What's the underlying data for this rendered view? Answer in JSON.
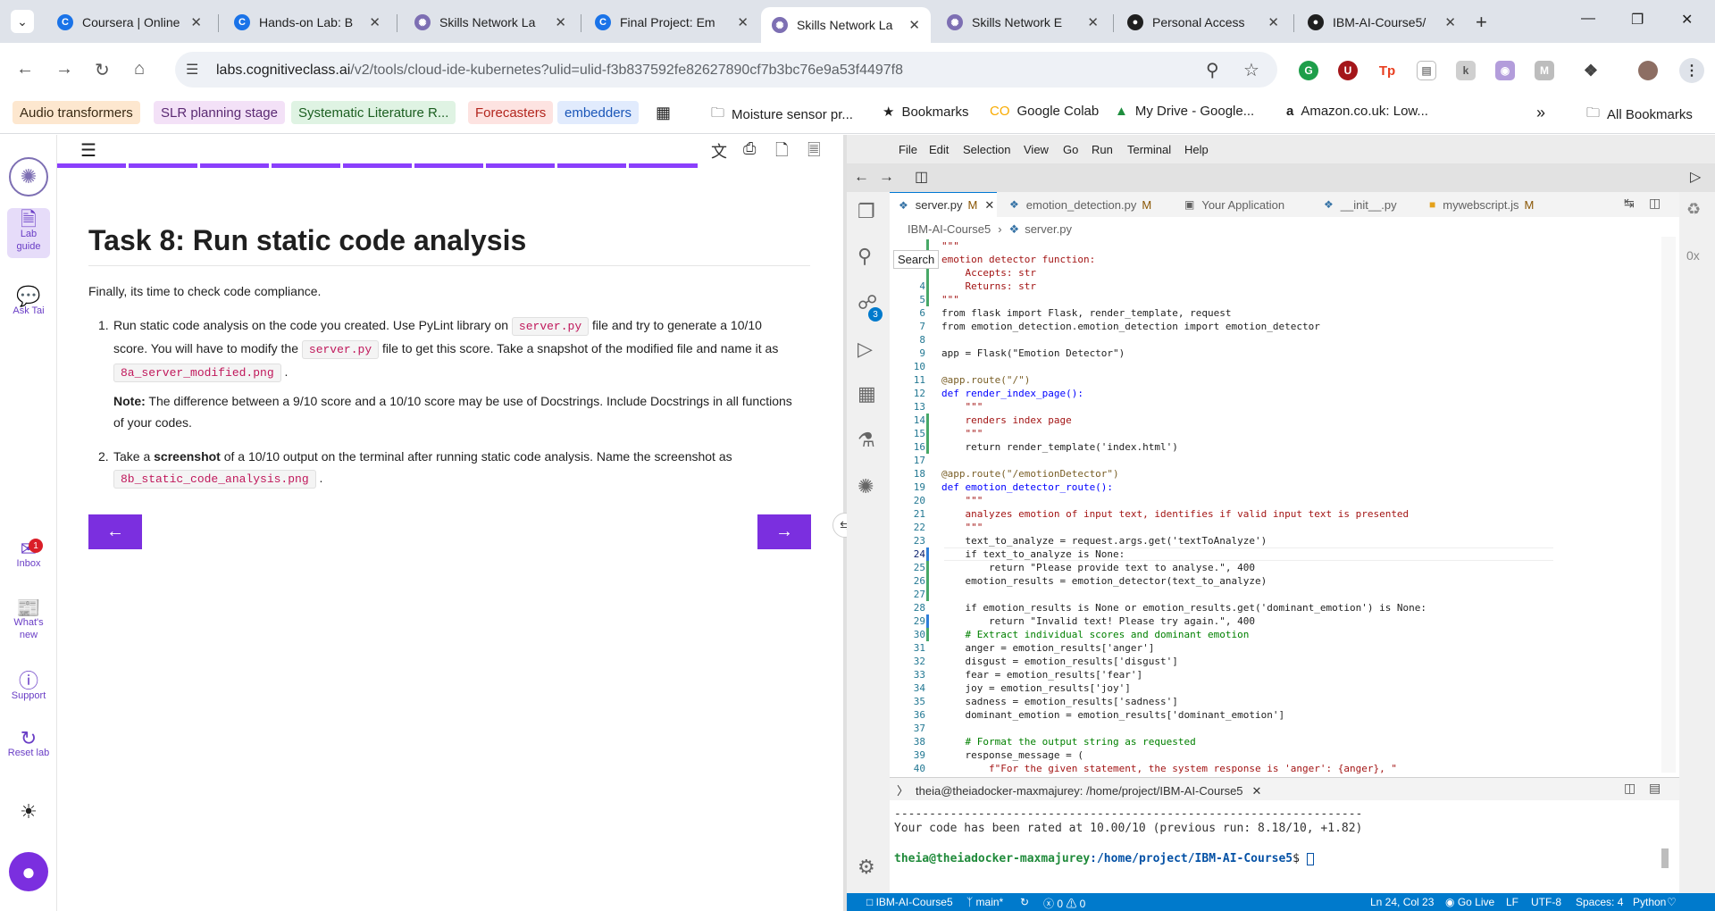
{
  "browser": {
    "tabs": [
      {
        "title": "Coursera | Online",
        "icon": "coursera-icon",
        "color": "#1a73e8"
      },
      {
        "title": "Hands-on Lab: B",
        "icon": "coursera-icon",
        "color": "#1a73e8"
      },
      {
        "title": "Skills Network La",
        "icon": "skills-network-icon",
        "color": "#7d6fb3"
      },
      {
        "title": "Final Project: Em",
        "icon": "coursera-icon",
        "color": "#1a73e8"
      },
      {
        "title": "Skills Network La",
        "icon": "skills-network-icon",
        "color": "#7d6fb3"
      },
      {
        "title": "Skills Network E",
        "icon": "skills-network-icon",
        "color": "#7d6fb3"
      },
      {
        "title": "Personal Access",
        "icon": "github-icon",
        "color": "#1f1f1f"
      },
      {
        "title": "IBM-AI-Course5/",
        "icon": "github-icon",
        "color": "#1f1f1f"
      }
    ],
    "active_tab_index": 4,
    "url_host": "labs.cognitiveclass.ai",
    "url_rest": "/v2/tools/cloud-ide-kubernetes?ulid=ulid-f3b837592fe82627890cf7b3bc76e9a53f4497f8",
    "bookmark_tags": [
      {
        "label": "Audio transformers",
        "bg": "#fde7cf"
      },
      {
        "label": "SLR planning stage",
        "bg": "#f3e1f7"
      },
      {
        "label": "Systematic Literature R...",
        "bg": "#dff3e3"
      },
      {
        "label": "Forecasters",
        "bg": "#fde3e1"
      },
      {
        "label": "embedders",
        "bg": "#e1ebfd"
      }
    ],
    "bookmarks": [
      {
        "label": "Moisture sensor pr...",
        "icon": "folder-icon"
      },
      {
        "label": "Bookmarks",
        "icon": "star-icon"
      },
      {
        "label": "Google Colab",
        "icon": "colab-icon"
      },
      {
        "label": "My Drive - Google...",
        "icon": "drive-icon"
      },
      {
        "label": "Amazon.co.uk: Low...",
        "icon": "amazon-icon"
      }
    ],
    "all_bookmarks": "All Bookmarks"
  },
  "rail": {
    "lab_guide": "Lab guide",
    "ask_tai": "Ask Tai",
    "inbox": "Inbox",
    "inbox_badge": "1",
    "whats_new": "What's new",
    "support": "Support",
    "reset_lab": "Reset lab"
  },
  "instructions": {
    "progress_segments": 9,
    "title": "Task 8: Run static code analysis",
    "intro": "Finally, its time to check code compliance.",
    "step1_num": "1.",
    "step1_a": "Run static code analysis on the code you created. Use PyLint library on",
    "step1_code1": "server.py",
    "step1_b": "file and try to generate a 10/10",
    "step1_c": "score. You will have to modify the",
    "step1_code2": "server.py",
    "step1_d": "file to get this score. Take a snapshot of the modified file and name it as",
    "step1_code3": "8a_server_modified.png",
    "step1_e": ".",
    "note_label": "Note:",
    "note_a": "The difference between a 9/10 score and a 10/10 score may be use of Docstrings. Include Docstrings in all functions",
    "note_b": "of your codes.",
    "step2_num": "2.",
    "step2_a": "Take a",
    "step2_bold": "screenshot",
    "step2_b": "of a 10/10 output on the terminal after running static code analysis. Name the screenshot as",
    "step2_code": "8b_static_code_analysis.png",
    "step2_c": "."
  },
  "ide": {
    "menu": [
      "File",
      "Edit",
      "Selection",
      "View",
      "Go",
      "Run",
      "Terminal",
      "Help"
    ],
    "scm_badge": "3",
    "editor_tabs": [
      {
        "label": "server.py",
        "mod": "M",
        "icon": "python-icon",
        "active": true
      },
      {
        "label": "emotion_detection.py",
        "mod": "M",
        "icon": "python-icon",
        "active": false
      },
      {
        "label": "Your Application",
        "mod": "",
        "icon": "preview-icon",
        "active": false
      },
      {
        "label": "__init__.py",
        "mod": "",
        "icon": "python-icon",
        "active": false
      },
      {
        "label": "mywebscript.js",
        "mod": "M",
        "icon": "js-icon",
        "active": false
      }
    ],
    "breadcrumb_folder": "IBM-AI-Course5",
    "breadcrumb_file": "server.py",
    "search_tooltip": "Search",
    "code_lines": [
      {
        "n": "",
        "t": "\"\"\"",
        "c": "str"
      },
      {
        "n": "",
        "t": "emotion detector function:",
        "c": "str"
      },
      {
        "n": "",
        "t": "    Accepts: str",
        "c": "str"
      },
      {
        "n": "4",
        "t": "    Returns: str",
        "c": "str"
      },
      {
        "n": "5",
        "t": "\"\"\"",
        "c": "str"
      },
      {
        "n": "6",
        "t": "from flask import Flask, render_template, request",
        "c": "plain"
      },
      {
        "n": "7",
        "t": "from emotion_detection.emotion_detection import emotion_detector",
        "c": "plain"
      },
      {
        "n": "8",
        "t": "",
        "c": "plain"
      },
      {
        "n": "9",
        "t": "app = Flask(\"Emotion Detector\")",
        "c": "plain"
      },
      {
        "n": "10",
        "t": "",
        "c": "plain"
      },
      {
        "n": "11",
        "t": "@app.route(\"/\")",
        "c": "dec"
      },
      {
        "n": "12",
        "t": "def render_index_page():",
        "c": "def"
      },
      {
        "n": "13",
        "t": "    \"\"\"",
        "c": "str"
      },
      {
        "n": "14",
        "t": "    renders index page",
        "c": "str"
      },
      {
        "n": "15",
        "t": "    \"\"\"",
        "c": "str"
      },
      {
        "n": "16",
        "t": "    return render_template('index.html')",
        "c": "plain"
      },
      {
        "n": "17",
        "t": "",
        "c": "plain"
      },
      {
        "n": "18",
        "t": "@app.route(\"/emotionDetector\")",
        "c": "dec"
      },
      {
        "n": "19",
        "t": "def emotion_detector_route():",
        "c": "def"
      },
      {
        "n": "20",
        "t": "    \"\"\"",
        "c": "str"
      },
      {
        "n": "21",
        "t": "    analyzes emotion of input text, identifies if valid input text is presented",
        "c": "str"
      },
      {
        "n": "22",
        "t": "    \"\"\"",
        "c": "str"
      },
      {
        "n": "23",
        "t": "    text_to_analyze = request.args.get('textToAnalyze')",
        "c": "plain"
      },
      {
        "n": "24",
        "t": "    if text_to_analyze is None:",
        "c": "plain"
      },
      {
        "n": "25",
        "t": "        return \"Please provide text to analyse.\", 400",
        "c": "plain"
      },
      {
        "n": "26",
        "t": "    emotion_results = emotion_detector(text_to_analyze)",
        "c": "plain"
      },
      {
        "n": "27",
        "t": "",
        "c": "plain"
      },
      {
        "n": "28",
        "t": "    if emotion_results is None or emotion_results.get('dominant_emotion') is None:",
        "c": "plain"
      },
      {
        "n": "29",
        "t": "        return \"Invalid text! Please try again.\", 400",
        "c": "plain"
      },
      {
        "n": "30",
        "t": "    # Extract individual scores and dominant emotion",
        "c": "cm"
      },
      {
        "n": "31",
        "t": "    anger = emotion_results['anger']",
        "c": "plain"
      },
      {
        "n": "32",
        "t": "    disgust = emotion_results['disgust']",
        "c": "plain"
      },
      {
        "n": "33",
        "t": "    fear = emotion_results['fear']",
        "c": "plain"
      },
      {
        "n": "34",
        "t": "    joy = emotion_results['joy']",
        "c": "plain"
      },
      {
        "n": "35",
        "t": "    sadness = emotion_results['sadness']",
        "c": "plain"
      },
      {
        "n": "36",
        "t": "    dominant_emotion = emotion_results['dominant_emotion']",
        "c": "plain"
      },
      {
        "n": "37",
        "t": "",
        "c": "plain"
      },
      {
        "n": "38",
        "t": "    # Format the output string as requested",
        "c": "cm"
      },
      {
        "n": "39",
        "t": "    response_message = (",
        "c": "plain"
      },
      {
        "n": "40",
        "t": "        f\"For the given statement, the system response is 'anger': {anger}, \"",
        "c": "str"
      }
    ],
    "terminal_tab": "theia@theiadocker-maxmajurey: /home/project/IBM-AI-Course5",
    "terminal_rule": "-------------------------------------------------------------------",
    "terminal_result": "Your code has been rated at 10.00/10 (previous run: 8.18/10, +1.82)",
    "prompt_user": "theia@theiadocker-maxmajurey",
    "prompt_path": ":/home/project/IBM-AI-Course5",
    "prompt_end": "$",
    "status": {
      "folder": "IBM-AI-Course5",
      "branch": "main*",
      "problems": "ⓧ 0 ⚠ 0",
      "position": "Ln 24, Col 23",
      "go_live": "Go Live",
      "eol": "LF",
      "encoding": "UTF-8",
      "spaces": "Spaces: 4",
      "language": "Python"
    }
  }
}
